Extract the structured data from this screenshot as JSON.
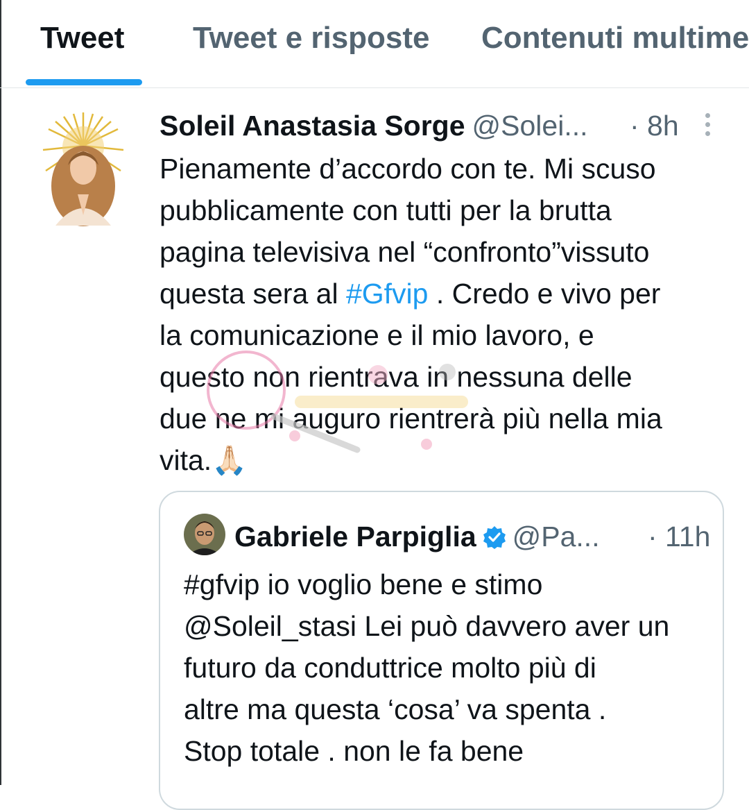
{
  "tabs": [
    {
      "label": "Tweet",
      "active": true
    },
    {
      "label": "Tweet e risposte",
      "active": false
    },
    {
      "label": "Contenuti multimedia",
      "active": false
    }
  ],
  "tweet": {
    "author_name": "Soleil Anastasia Sorge",
    "handle": "@Solei...",
    "time": "· 8h",
    "text_before": "Pienamente d’accordo con te. Mi scuso\npubblicamente con tutti per la brutta\npagina televisiva nel “confronto”vissuto\nquesta sera al ",
    "hashtag": "#Gfvip",
    "text_after": " . Credo e vivo per\nla comunicazione e il mio lavoro, e\nquesto non rientrava in nessuna delle\ndue ne mi auguro rientrerà più nella mia\nvita.🙏🏻"
  },
  "quoted_tweet": {
    "author_name": "Gabriele Parpiglia",
    "handle": "@Pa...",
    "time": "· 11h",
    "text": "#gfvip io voglio bene e stimo\n@Soleil_stasi Lei può davvero aver un\nfuturo da conduttrice molto più di\naltre ma questa ‘cosa’ va spenta .\nStop totale . non le fa bene"
  },
  "icons": {
    "more": "more-vertical-icon",
    "verified": "verified-badge-icon"
  },
  "colors": {
    "accent": "#1d9bf0",
    "secondary_text": "#536471",
    "primary_text": "#0f1419",
    "border": "#cfd9de"
  }
}
